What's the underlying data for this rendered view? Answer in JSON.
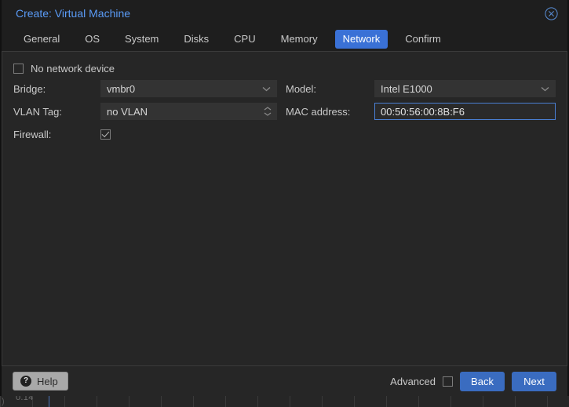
{
  "window": {
    "title": "Create: Virtual Machine",
    "close_icon": "close-circle-icon"
  },
  "tabs": [
    {
      "label": "General",
      "active": false
    },
    {
      "label": "OS",
      "active": false
    },
    {
      "label": "System",
      "active": false
    },
    {
      "label": "Disks",
      "active": false
    },
    {
      "label": "CPU",
      "active": false
    },
    {
      "label": "Memory",
      "active": false
    },
    {
      "label": "Network",
      "active": true
    },
    {
      "label": "Confirm",
      "active": false
    }
  ],
  "form": {
    "no_network_device": {
      "label": "No network device",
      "checked": false
    },
    "left": {
      "bridge": {
        "label": "Bridge:",
        "value": "vmbr0",
        "icon": "chevron-down-icon"
      },
      "vlan_tag": {
        "label": "VLAN Tag:",
        "value": "",
        "placeholder": "no VLAN",
        "icon": "spinner-updown-icon"
      },
      "firewall": {
        "label": "Firewall:",
        "checked": true
      }
    },
    "right": {
      "model": {
        "label": "Model:",
        "value": "Intel E1000",
        "icon": "chevron-down-icon"
      },
      "mac_address": {
        "label": "MAC address:",
        "value": "00:50:56:00:8B:F6",
        "focused": true
      }
    }
  },
  "footer": {
    "help_label": "Help",
    "help_icon": "question-mark-icon",
    "advanced_label": "Advanced",
    "advanced_checked": false,
    "back_label": "Back",
    "next_label": "Next"
  },
  "background_page": {
    "partial_value": "0.14"
  },
  "colors": {
    "accent_blue": "#3a71d6",
    "title_blue": "#5a9bf6",
    "button_blue": "#3a6cc0",
    "dialog_bg": "#262626",
    "header_bg": "#1e1e1e",
    "field_bg": "#333333",
    "focus_border": "#4a7fd4",
    "text": "#c9c9c9"
  }
}
